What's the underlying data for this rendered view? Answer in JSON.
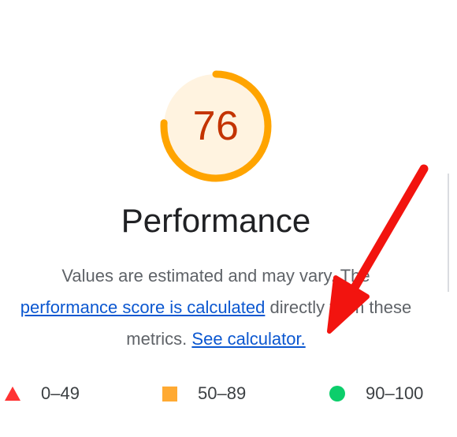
{
  "score": {
    "value": "76",
    "fraction": 0.76,
    "ring_color": "#ffa400",
    "fill_color": "#fff3e0",
    "text_color": "#c33300"
  },
  "title": "Performance",
  "description": {
    "part1": "Values are estimated and may vary. The ",
    "link1": "performance score is calculated",
    "part2": " directly from these metrics. ",
    "link2": "See calculator."
  },
  "legend": [
    {
      "range": "0–49",
      "icon": "red-triangle-icon",
      "color": "#ff3333"
    },
    {
      "range": "50–89",
      "icon": "orange-square-icon",
      "color": "#ffaa33"
    },
    {
      "range": "90–100",
      "icon": "green-circle-icon",
      "color": "#0cce6b"
    }
  ],
  "annotation": {
    "icon": "red-arrow-icon",
    "color": "#f2140f"
  }
}
